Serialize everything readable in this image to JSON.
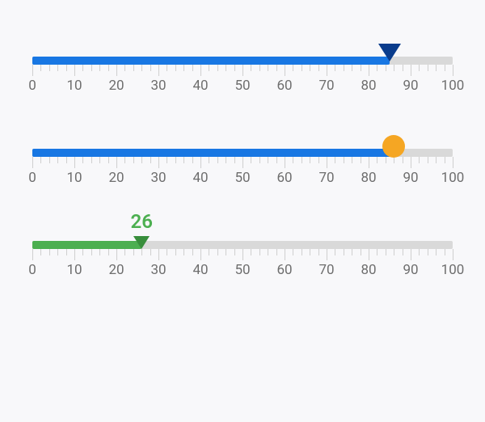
{
  "chart_data": [
    {
      "type": "slider",
      "min": 0,
      "max": 100,
      "ticks_major": [
        0,
        10,
        20,
        30,
        40,
        50,
        60,
        70,
        80,
        90,
        100
      ],
      "minor_step": 2,
      "value": 85,
      "fill_color": "#1877e3",
      "thumb": {
        "shape": "triangle",
        "color": "#0a3c8c"
      }
    },
    {
      "type": "slider",
      "min": 0,
      "max": 100,
      "ticks_major": [
        0,
        10,
        20,
        30,
        40,
        50,
        60,
        70,
        80,
        90,
        100
      ],
      "minor_step": 2,
      "value": 86,
      "fill_color": "#1877e3",
      "thumb": {
        "shape": "circle",
        "color": "#f5a623"
      }
    },
    {
      "type": "slider",
      "min": 0,
      "max": 100,
      "ticks_major": [
        0,
        10,
        20,
        30,
        40,
        50,
        60,
        70,
        80,
        90,
        100
      ],
      "minor_step": 2,
      "value": 26,
      "value_label": "26",
      "fill_color": "#4caf50",
      "thumb": {
        "shape": "triangle-small",
        "color": "#388e3c"
      }
    }
  ]
}
